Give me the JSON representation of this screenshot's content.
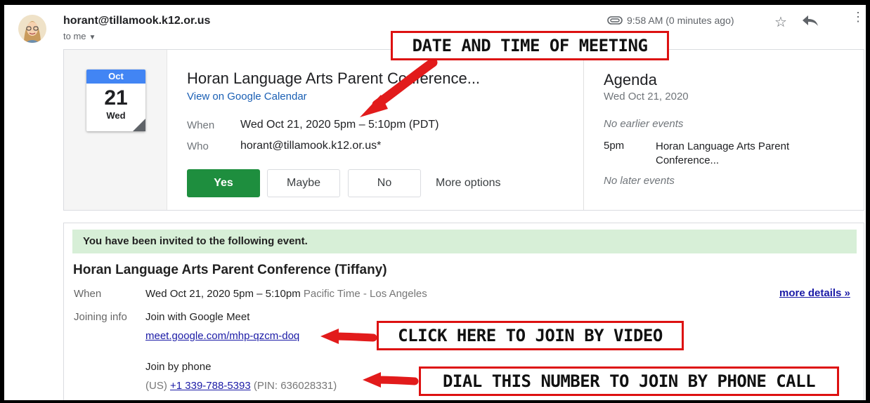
{
  "header": {
    "sender": "horant@tillamook.k12.or.us",
    "to_me": "to me",
    "time": "9:58 AM (0 minutes ago)"
  },
  "calendar_card": {
    "icon": {
      "month": "Oct",
      "day": "21",
      "weekday": "Wed"
    },
    "title": "Horan Language Arts Parent Conference...",
    "view_link": "View on Google Calendar",
    "when_label": "When",
    "when_value": "Wed Oct 21, 2020 5pm – 5:10pm (PDT)",
    "who_label": "Who",
    "who_value": "horant@tillamook.k12.or.us*",
    "buttons": {
      "yes": "Yes",
      "maybe": "Maybe",
      "no": "No",
      "more": "More options"
    }
  },
  "agenda": {
    "title": "Agenda",
    "date": "Wed Oct 21, 2020",
    "no_earlier": "No earlier events",
    "event_time": "5pm",
    "event_title": "Horan Language Arts Parent Conference...",
    "no_later": "No later events"
  },
  "invitation": {
    "banner": "You have been invited to the following event.",
    "title": "Horan Language Arts Parent Conference (Tiffany)",
    "when_label": "When",
    "when_value": "Wed Oct 21, 2020 5pm – 5:10pm",
    "timezone": "Pacific Time - Los Angeles",
    "more_details": "more details »",
    "joining_label": "Joining info",
    "meet_heading": "Join with Google Meet",
    "meet_link": "meet.google.com/mhp-qzcm-doq",
    "phone_heading": "Join by phone",
    "phone_country": "(US)",
    "phone_number": "+1 339-788-5393",
    "phone_pin": "(PIN: 636028331)"
  },
  "annotations": {
    "date_time": "DATE AND TIME OF MEETING",
    "video": "CLICK HERE TO JOIN BY VIDEO",
    "phone": "DIAL THIS NUMBER TO JOIN BY PHONE CALL"
  },
  "colors": {
    "accept_green": "#1e8e3e",
    "calendar_blue": "#4285f4",
    "banner_green": "#d7efd7",
    "annotation_red": "#d11111"
  }
}
